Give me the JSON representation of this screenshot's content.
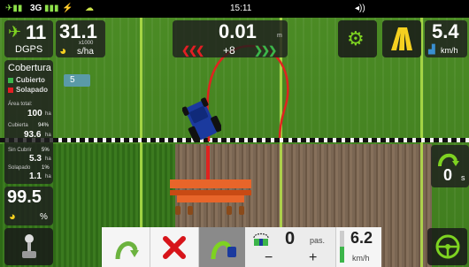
{
  "status": {
    "network": "3G",
    "time": "15:11"
  },
  "gps": {
    "satellites": "11",
    "mode": "DGPS"
  },
  "rate": {
    "value": "31.1",
    "unit_top": "x1000",
    "unit_bottom": "s/ha"
  },
  "guidance": {
    "offset": "0.01",
    "offset_unit": "m",
    "line_number": "+8"
  },
  "speed_top": {
    "value": "5.4",
    "unit": "km/h"
  },
  "coverage": {
    "title": "Cobertura",
    "legend_covered": "Cubierto",
    "legend_overlap": "Solapado",
    "area_total_label": "Área total:",
    "area_total_value": "100",
    "area_total_unit": "ha",
    "covered_label": "Cubierta",
    "covered_pct": "94%",
    "covered_value": "93.6",
    "covered_unit": "ha",
    "uncovered_label": "Sin Cubrir",
    "uncovered_pct": "5%",
    "uncovered_value": "5.3",
    "uncovered_unit": "ha",
    "overlap_label": "Solapado",
    "overlap_pct": "1%",
    "overlap_value": "1.1",
    "overlap_unit": "ha"
  },
  "marker": {
    "label": "5"
  },
  "efficiency": {
    "value": "99.5",
    "unit": "%"
  },
  "turn": {
    "value": "0",
    "unit": "s"
  },
  "bottom": {
    "passes_value": "0",
    "passes_unit": "pas.",
    "minus": "−",
    "plus": "+",
    "speed_value": "6.2",
    "speed_unit": "km/h"
  },
  "colors": {
    "covered": "#3cb54a",
    "overlap": "#e31e24",
    "accent_green": "#7ed321",
    "cancel_red": "#d7141a",
    "path_red": "#e0231f"
  }
}
